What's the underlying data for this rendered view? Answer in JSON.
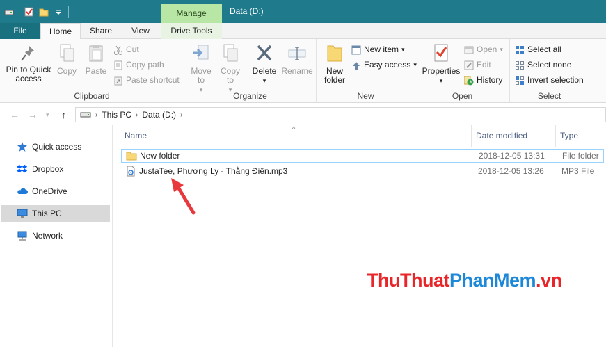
{
  "window": {
    "title": "Data (D:)",
    "context_tab": "Manage"
  },
  "tabs": {
    "file": "File",
    "home": "Home",
    "share": "Share",
    "view": "View",
    "drive_tools": "Drive Tools"
  },
  "ribbon": {
    "clipboard": {
      "label": "Clipboard",
      "pin": "Pin to Quick access",
      "copy": "Copy",
      "paste": "Paste",
      "cut": "Cut",
      "copy_path": "Copy path",
      "paste_shortcut": "Paste shortcut"
    },
    "organize": {
      "label": "Organize",
      "move_to": "Move to",
      "copy_to": "Copy to",
      "delete": "Delete",
      "rename": "Rename"
    },
    "new": {
      "label": "New",
      "new_folder": "New folder",
      "new_item": "New item",
      "easy_access": "Easy access"
    },
    "open": {
      "label": "Open",
      "properties": "Properties",
      "open": "Open",
      "edit": "Edit",
      "history": "History"
    },
    "select": {
      "label": "Select",
      "select_all": "Select all",
      "select_none": "Select none",
      "invert_selection": "Invert selection"
    }
  },
  "address": {
    "crumbs": [
      "This PC",
      "Data (D:)"
    ]
  },
  "nav_pane": {
    "items": [
      {
        "label": "Quick access"
      },
      {
        "label": "Dropbox"
      },
      {
        "label": "OneDrive"
      },
      {
        "label": "This PC"
      },
      {
        "label": "Network"
      }
    ],
    "selected": "This PC"
  },
  "file_list": {
    "columns": {
      "name": "Name",
      "date": "Date modified",
      "type": "Type"
    },
    "rows": [
      {
        "name": "New folder",
        "date": "2018-12-05 13:31",
        "type": "File folder"
      },
      {
        "name": "JustaTee, Phương Ly - Thằng Điên.mp3",
        "date": "2018-12-05 13:26",
        "type": "MP3 File"
      }
    ]
  },
  "watermark": {
    "part1": "ThuThuat",
    "part2": "PhanMem",
    "part3": ".vn"
  },
  "colors": {
    "titlebar": "#1f7a8c",
    "manage_tab": "#b8e7a5",
    "annotation_arrow": "#e8383d"
  }
}
